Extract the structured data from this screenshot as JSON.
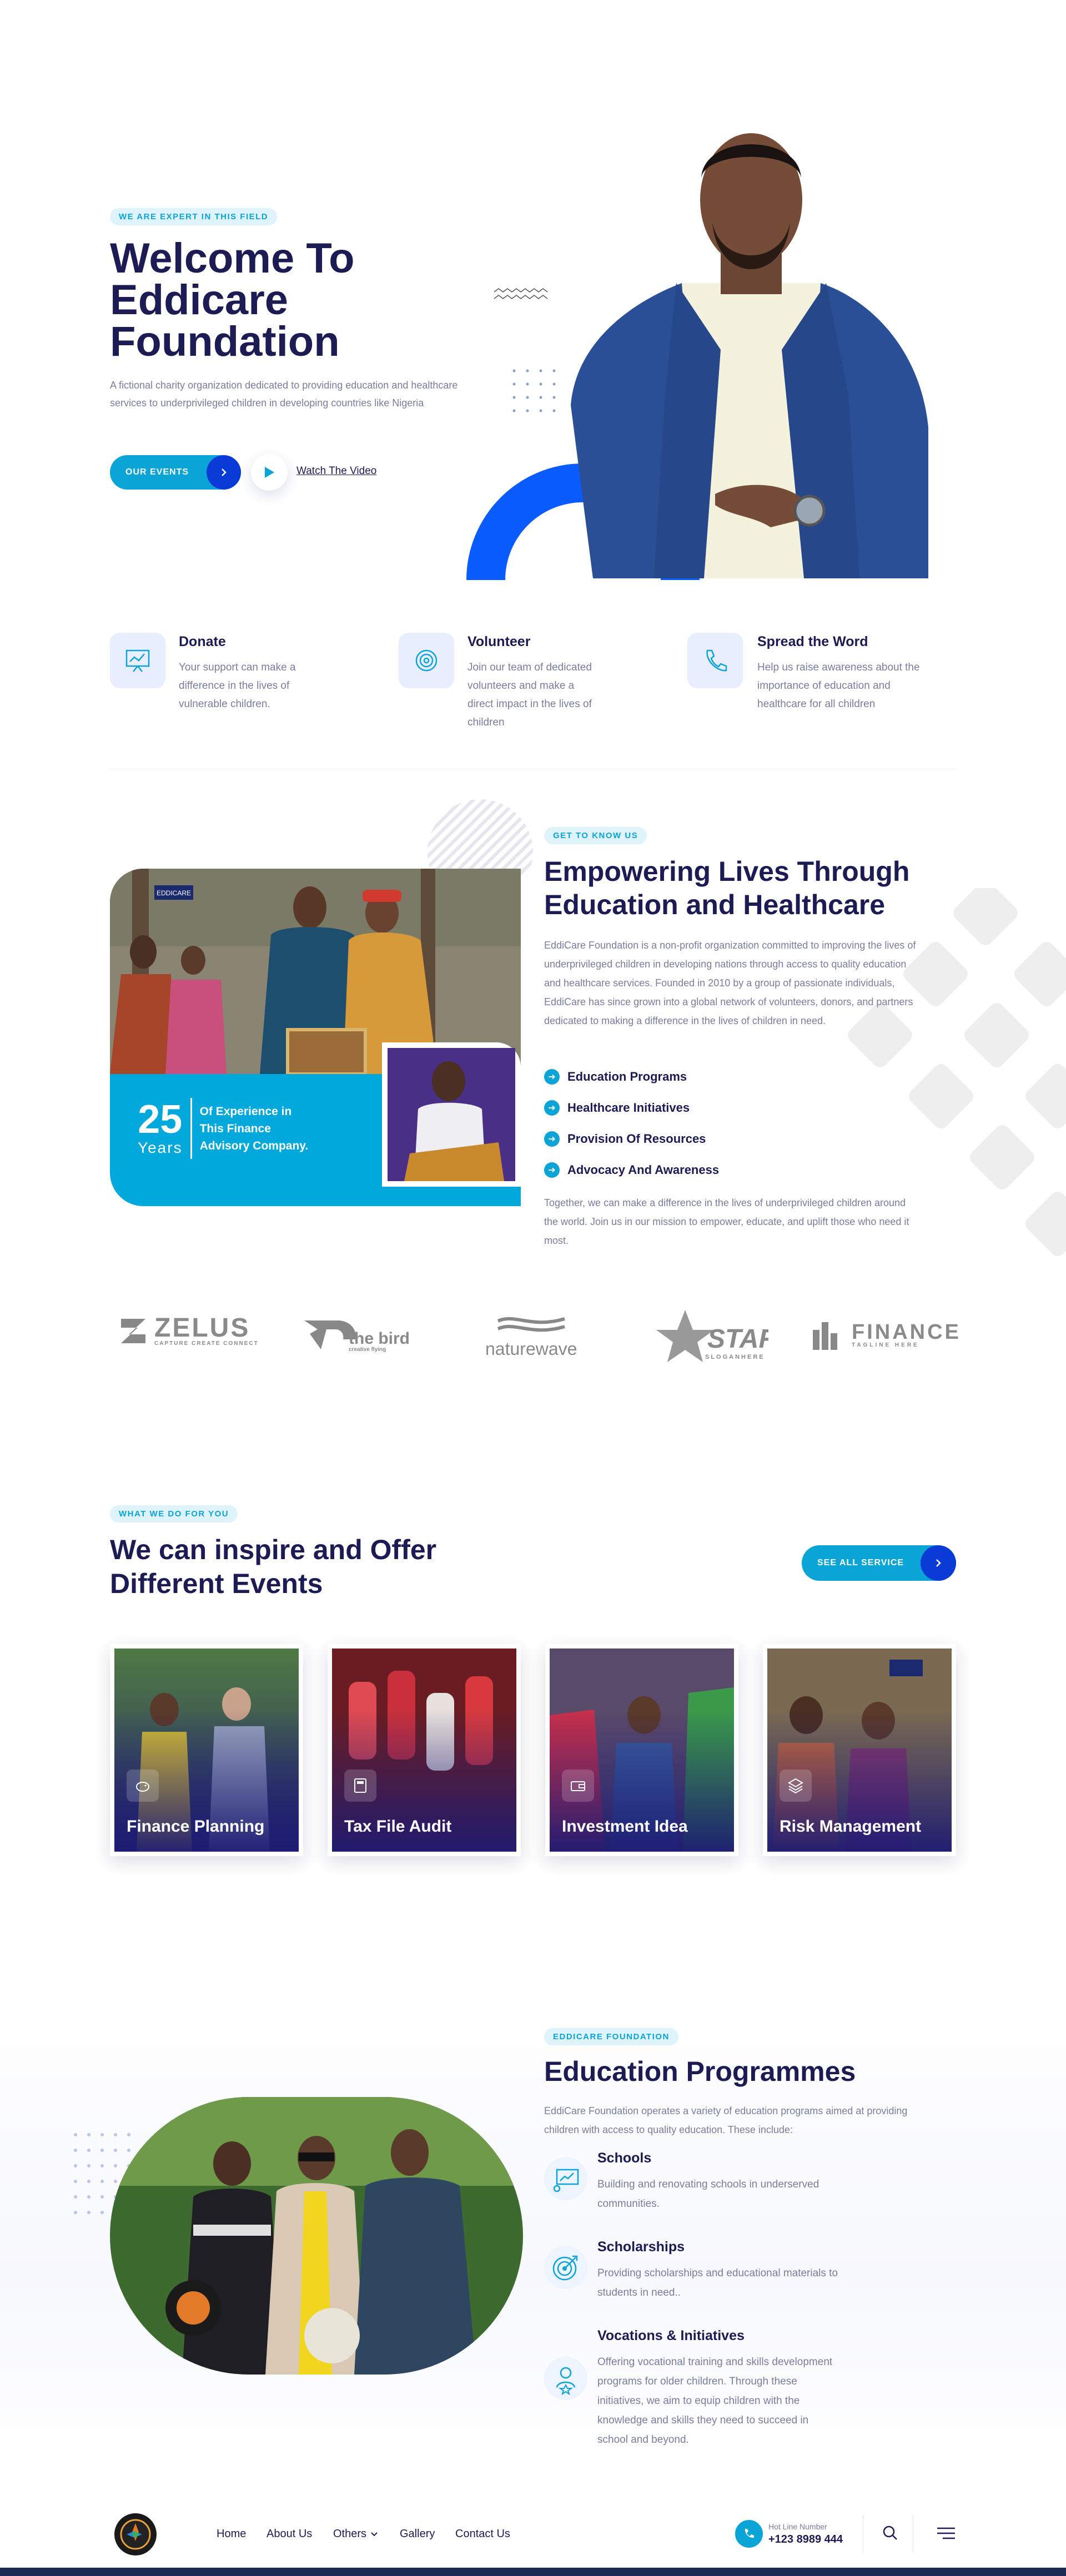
{
  "hero": {
    "tag": "WE ARE EXPERT IN THIS FIELD",
    "title_line1": "Welcome To",
    "title_line2": "Eddicare",
    "title_line3": "Foundation",
    "desc": "A fictional charity organization dedicated to providing education and healthcare services to underprivileged children in developing countries like Nigeria",
    "events_btn": "OUR EVENTS",
    "video_link": "Watch The Video"
  },
  "features": [
    {
      "title": "Donate",
      "desc": "Your support can make a difference in the lives of vulnerable children."
    },
    {
      "title": "Volunteer",
      "desc": "Join our team of dedicated volunteers and make a direct impact in the lives of children"
    },
    {
      "title": "Spread the Word",
      "desc": "Help us raise awareness about the importance of education and healthcare for all children"
    }
  ],
  "about": {
    "tag": "GET TO KNOW US",
    "title_line1": "Empowering Lives Through",
    "title_line2": "Education and Healthcare",
    "desc": "EddiCare Foundation is a non-profit organization committed to improving the lives of underprivileged children in developing nations through access to quality education and healthcare services. Founded in 2010 by a group of passionate individuals, EddiCare has since grown into a global network of volunteers, donors, and partners dedicated to making a difference in the lives of children in need.",
    "checks": [
      "Education Programs",
      "Healthcare Initiatives",
      "Provision Of Resources",
      "Advocacy And Awareness"
    ],
    "closing": "Together, we can make a difference in the lives of underprivileged children around the world. Join us in our mission to empower, educate, and uplift those who need it most.",
    "years_num": "25",
    "years_word": "Years",
    "years_text": "Of Experience in This Finance Advisory Company.",
    "photo_badge": "EDDICARE"
  },
  "partners": [
    {
      "name": "ZELUS",
      "sub": "CAPTURE CREATE CONNECT"
    },
    {
      "name": "the bird",
      "sub": "creative flying"
    },
    {
      "name": "naturewave",
      "sub": ""
    },
    {
      "name": "STAR",
      "sub": "SLOGANHERE"
    },
    {
      "name": "FINANCE",
      "sub": "TAGLINE HERE"
    }
  ],
  "services": {
    "tag": "WHAT WE DO FOR YOU",
    "title_line1": "We can inspire and Offer",
    "title_line2": "Different Events",
    "all_btn": "SEE ALL SERVICE",
    "cards": [
      {
        "label": "Finance Planning",
        "icon": "piggy-bank-icon"
      },
      {
        "label": "Tax File Audit",
        "icon": "calculator-icon"
      },
      {
        "label": "Investment Idea",
        "icon": "wallet-icon"
      },
      {
        "label": "Risk Management",
        "icon": "layers-icon"
      }
    ]
  },
  "education": {
    "tag": "EDDICARE FOUNDATION",
    "title": "Education Programmes",
    "desc": "EddiCare Foundation operates a variety of education programs aimed at providing children with access to quality education. These include:",
    "items": [
      {
        "title": "Schools",
        "desc": "Building and renovating schools in underserved communities."
      },
      {
        "title": "Scholarships",
        "desc": "Providing scholarships and educational materials to students in need.."
      },
      {
        "title": "Vocations & Initiatives",
        "desc": "Offering vocational training and skills development programs for older children. Through these initiatives, we aim to equip children with the knowledge and skills they need to succeed in school and beyond."
      }
    ]
  },
  "nav": {
    "home": "Home",
    "about": "About Us",
    "others": "Others",
    "gallery": "Gallery",
    "contact": "Contact Us",
    "hotline_label": "Hot Line Number",
    "hotline": "+123 8989 444"
  },
  "colors": {
    "primary": "#1d1b53",
    "accent": "#0aa4d6",
    "blue": "#0b5cff",
    "deep": "#0b3bd6"
  }
}
